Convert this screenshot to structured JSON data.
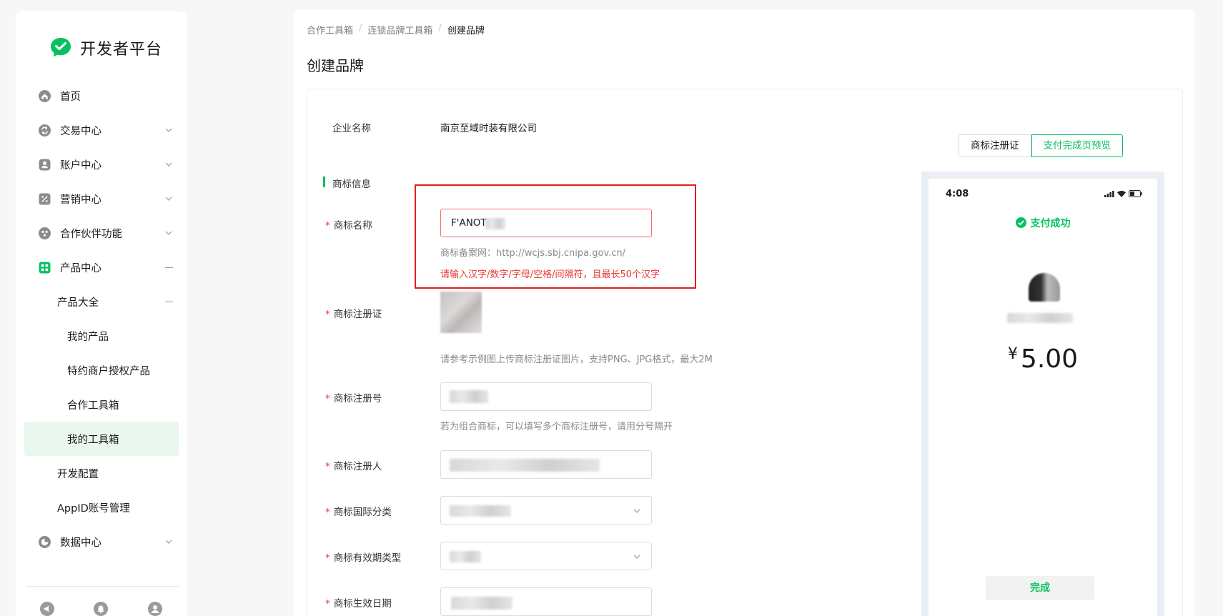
{
  "brand": {
    "name": "开发者平台",
    "color": "#07c160"
  },
  "sidebar": {
    "items": [
      {
        "label": "首页",
        "icon": "home-icon"
      },
      {
        "label": "交易中心",
        "icon": "exchange-icon"
      },
      {
        "label": "账户中心",
        "icon": "account-icon"
      },
      {
        "label": "营销中心",
        "icon": "coupon-icon"
      },
      {
        "label": "合作伙伴功能",
        "icon": "partner-icon"
      },
      {
        "label": "产品中心",
        "icon": "grid-icon"
      },
      {
        "label": "产品大全"
      },
      {
        "label": "我的产品"
      },
      {
        "label": "特约商户授权产品"
      },
      {
        "label": "合作工具箱"
      },
      {
        "label": "我的工具箱"
      },
      {
        "label": "开发配置"
      },
      {
        "label": "AppID账号管理"
      },
      {
        "label": "数据中心",
        "icon": "chart-icon"
      }
    ]
  },
  "breadcrumb": {
    "items": [
      "合作工具箱",
      "连锁品牌工具箱"
    ],
    "current": "创建品牌",
    "sep": "/"
  },
  "page": {
    "title": "创建品牌"
  },
  "form": {
    "company_label": "企业名称",
    "company_value": "南京至域时装有限公司",
    "section_title": "商标信息",
    "required_mark": "*",
    "trademark_name_label": "商标名称",
    "trademark_name_value": "F'ANOT",
    "trademark_site_hint": "商标备案网：http://wcjs.sbj.cnipa.gov.cn/",
    "trademark_name_error": "请输入汉字/数字/字母/空格/间隔符，且最长50个汉字",
    "cert_label": "商标注册证",
    "cert_hint": "请参考示例图上传商标注册证图片，支持PNG、JPG格式，最大2M",
    "reg_no_label": "商标注册号",
    "reg_no_hint": "若为组合商标，可以填写多个商标注册号，请用分号隔开",
    "registrant_label": "商标注册人",
    "intl_class_label": "商标国际分类",
    "validity_type_label": "商标有效期类型",
    "effective_date_label": "商标生效日期"
  },
  "preview": {
    "tabs": [
      "商标注册证",
      "支付完成页预览"
    ],
    "active_tab": 1,
    "time": "4:08",
    "success_text": "支付成功",
    "currency": "¥",
    "amount": "5.00",
    "done_label": "完成"
  }
}
